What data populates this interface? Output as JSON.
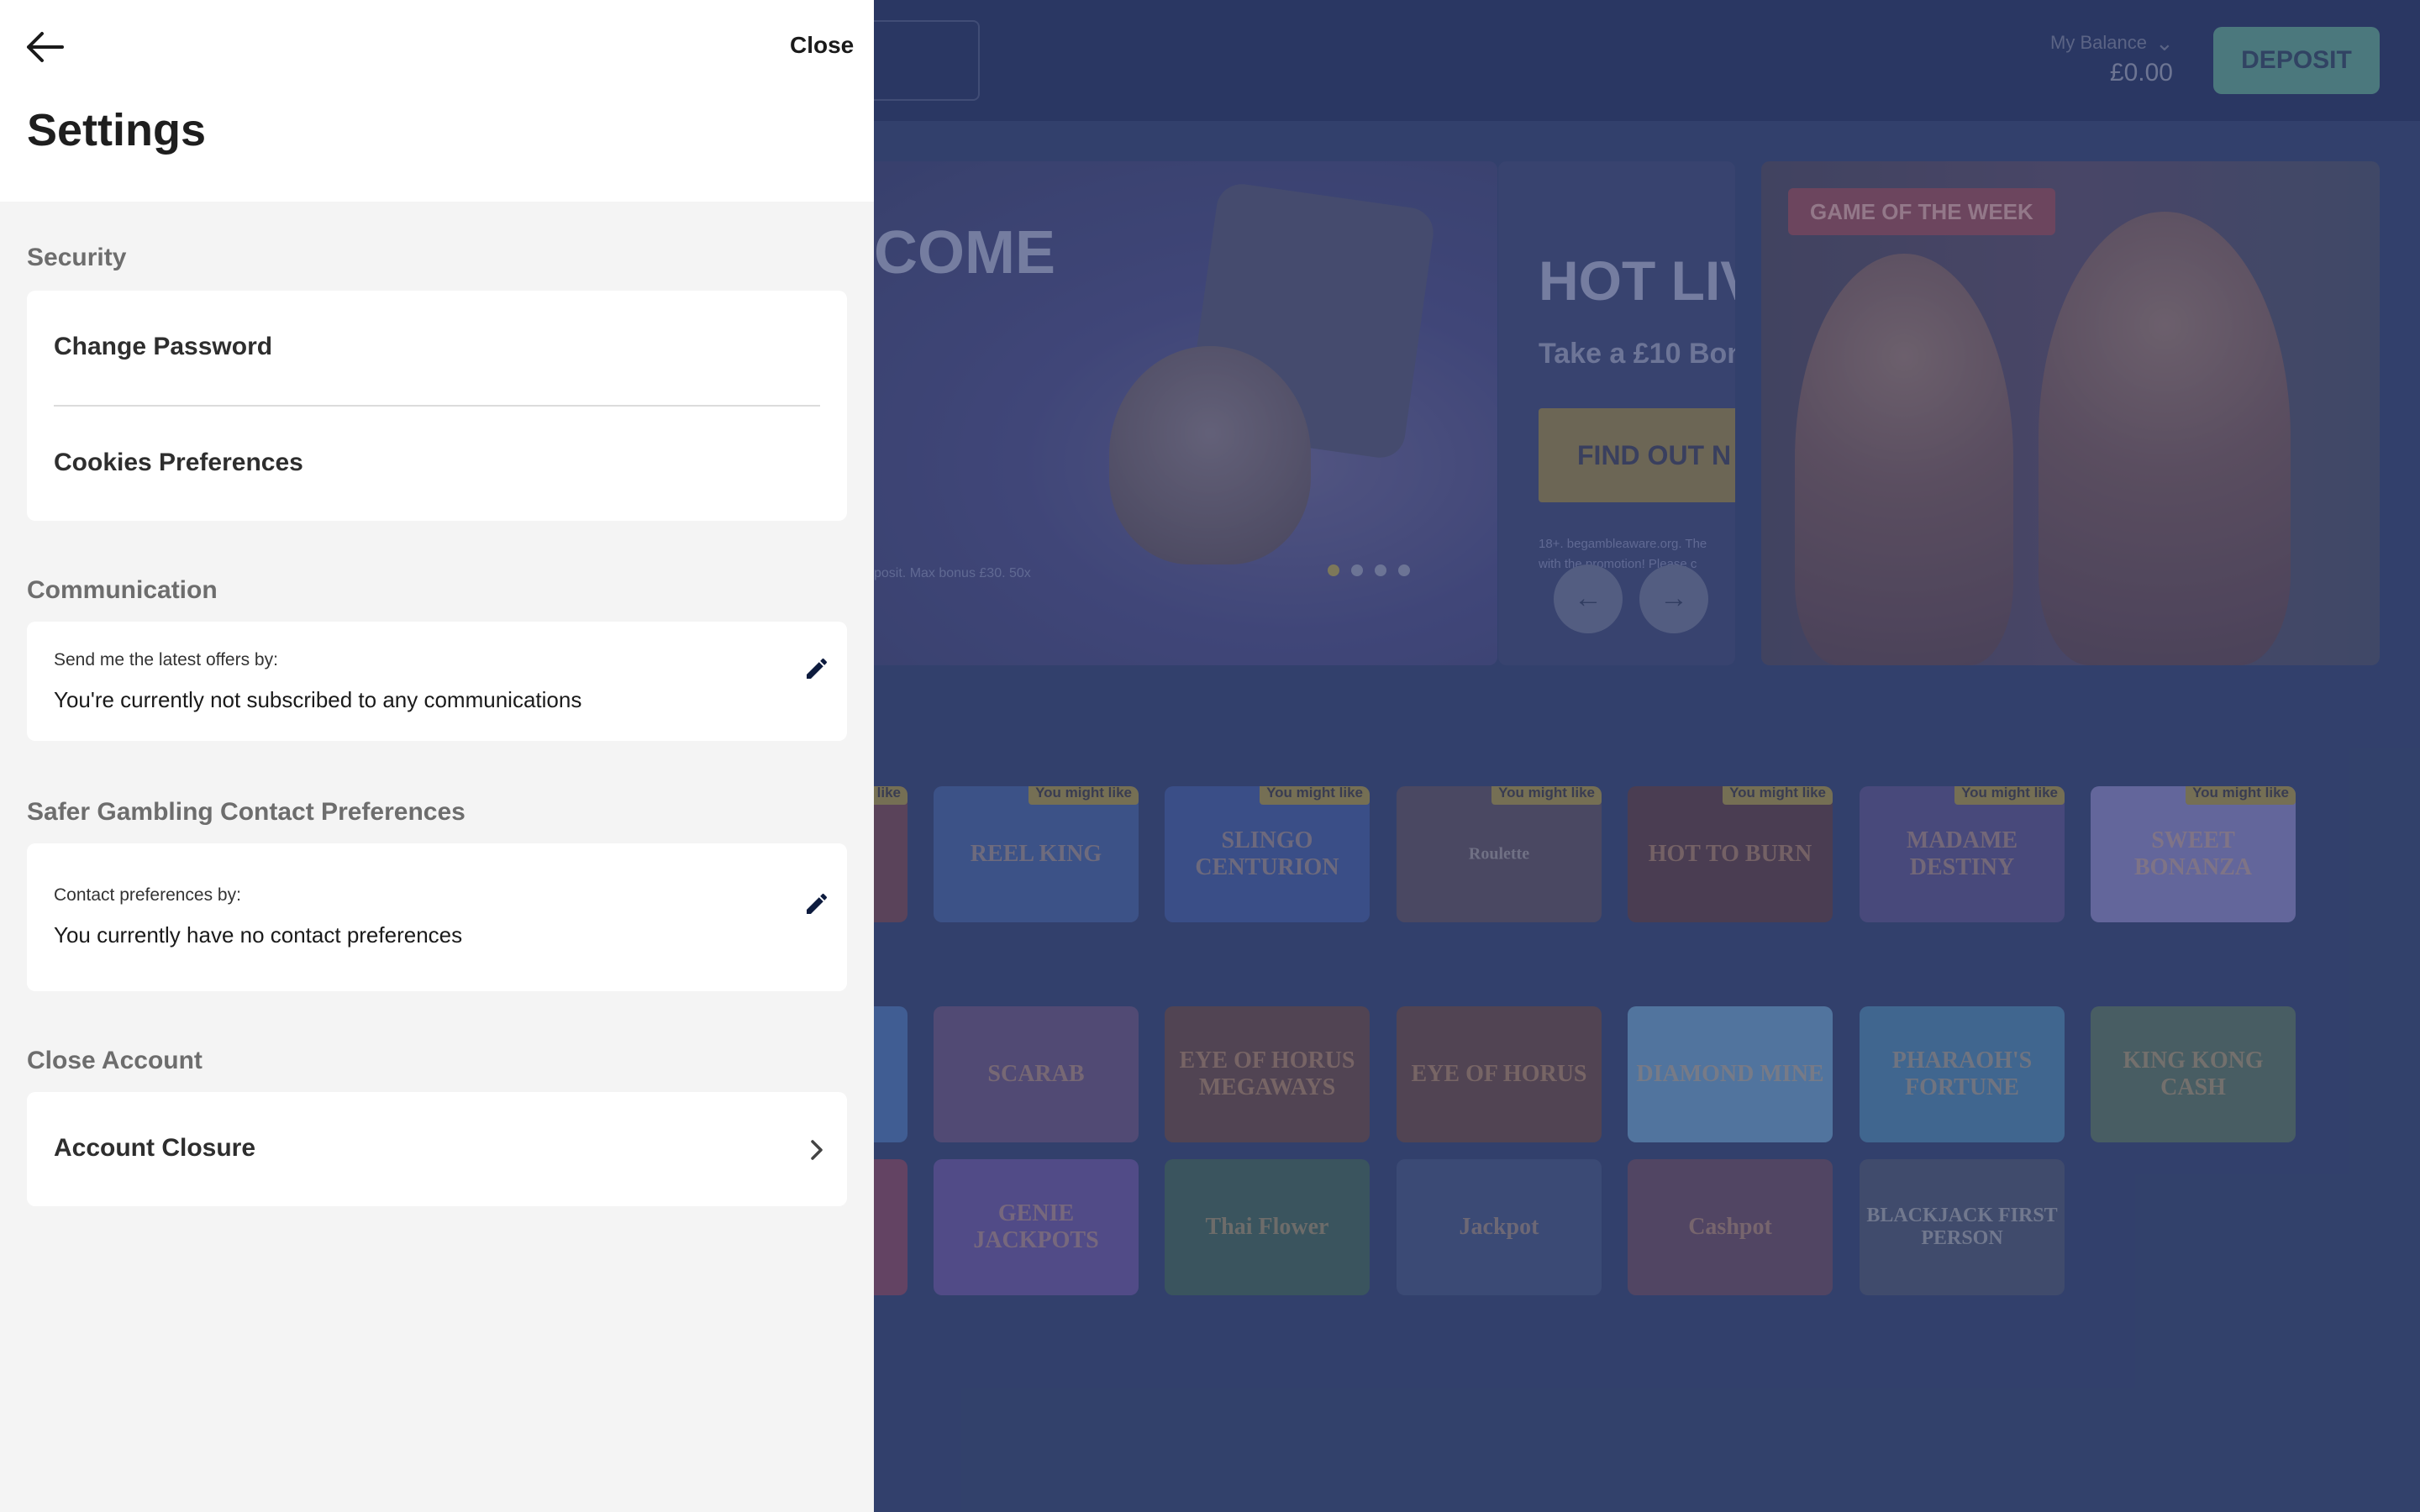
{
  "background_page": {
    "balance_label": "My Balance",
    "balance_value": "£0.00",
    "deposit_label": "DEPOSIT",
    "banner_welcome_title": "COME",
    "banner_welcome_terms": "posit. Max bonus £30. 50x",
    "banner_hot_title": "HOT LIV",
    "banner_hot_subtitle": "Take a £10 Bon",
    "banner_hot_cta": "FIND OUT N",
    "banner_hot_terms_1": "18+. begambleaware.org. The",
    "banner_hot_terms_2": "with the promotion! Please c",
    "game_of_the_week_label": "GAME OF THE WEEK",
    "you_might_like_label": "You might like",
    "games_row_1": [
      "",
      "REEL KING",
      "SLINGO CENTURION",
      "Roulette",
      "HOT TO BURN",
      "MADAME DESTINY",
      "SWEET BONANZA"
    ],
    "games_row_2": [
      "",
      "SCARAB",
      "EYE OF HORUS MEGAWAYS",
      "EYE OF HORUS",
      "DIAMOND MINE",
      "PHARAOH'S FORTUNE",
      "KING KONG CASH"
    ],
    "games_row_3": [
      "",
      "GENIE JACKPOTS",
      "Thai Flower",
      "Jackpot",
      "Cashpot",
      "BLACKJACK FIRST PERSON"
    ]
  },
  "drawer": {
    "close_label": "Close",
    "title": "Settings",
    "security": {
      "heading": "Security",
      "change_password": "Change Password",
      "cookies_preferences": "Cookies Preferences"
    },
    "communication": {
      "heading": "Communication",
      "label": "Send me the latest offers by:",
      "value": "You're currently not subscribed to any communications"
    },
    "safer_gambling": {
      "heading": "Safer Gambling Contact Preferences",
      "label": "Contact preferences by:",
      "value": "You currently have no contact preferences"
    },
    "close_account": {
      "heading": "Close Account",
      "account_closure": "Account Closure"
    }
  },
  "icons": {
    "back": "arrow-left-icon",
    "edit": "pencil-icon",
    "chevron": "chevron-right-icon",
    "balance_toggle": "chevron-down-icon"
  },
  "colors": {
    "background_topbar": "#031449",
    "deposit_button": "#3f8a79",
    "drawer_background": "#f4f4f4",
    "card_background": "#ffffff",
    "overlay_tint": "#5a6282"
  }
}
